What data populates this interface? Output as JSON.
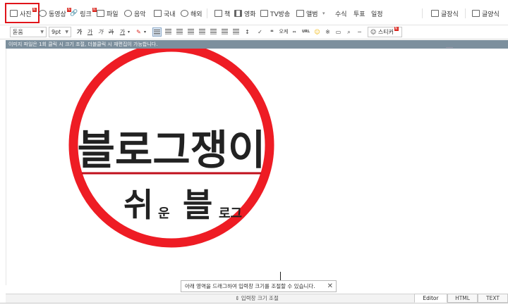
{
  "toolbar": {
    "photo": "사진",
    "video": "동영상",
    "link": "링크",
    "file": "파일",
    "music": "음악",
    "domestic": "국내",
    "overseas": "해외",
    "book": "책",
    "movie": "영화",
    "tv": "TV방송",
    "album": "앨범",
    "formula": "수식",
    "vote": "투표",
    "schedule": "일정",
    "quote_style": "글장식",
    "text_style": "글양식",
    "new_badge": "N"
  },
  "format": {
    "font_family": "돋움",
    "font_size": "9pt",
    "bold": "가",
    "underline": "가",
    "italic": "가",
    "strike": "가",
    "color": "가",
    "quote": "❝",
    "ok": "오케",
    "tag_label": "URL",
    "sticker": "스티커"
  },
  "info_bar": {
    "text": "이미지 파일은 1회 클릭 시 크기 조절, 더블클릭 시 재편집이 가능합니다."
  },
  "image": {
    "line1": "블로그쟁이",
    "big_a": "쉬",
    "small_a": "운",
    "big_b": "블",
    "small_b": "로그",
    "ring_color": "#ee1c24",
    "line_color": "#c0101c"
  },
  "bottom": {
    "hint": "아래 영역을 드래그하여 입력창 크기를 조절할 수 있습니다.",
    "close": "✕",
    "resize": "⇕ 입력창 크기 조절",
    "tabs": [
      "Editor",
      "HTML",
      "TEXT"
    ]
  }
}
